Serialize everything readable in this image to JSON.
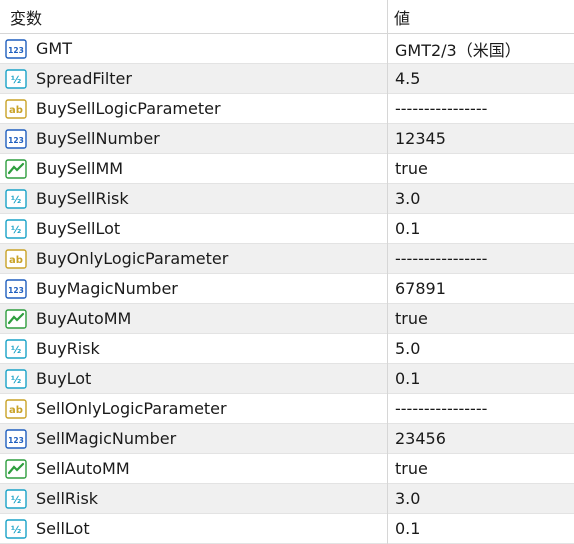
{
  "header": {
    "name": "変数",
    "value": "値"
  },
  "rows": [
    {
      "type": "int",
      "name": "GMT",
      "value": "GMT2/3（米国）"
    },
    {
      "type": "double",
      "name": "SpreadFilter",
      "value": "4.5"
    },
    {
      "type": "string",
      "name": "BuySellLogicParameter",
      "value": "----------------"
    },
    {
      "type": "int",
      "name": "BuySellNumber",
      "value": "12345"
    },
    {
      "type": "bool",
      "name": "BuySellMM",
      "value": "true"
    },
    {
      "type": "double",
      "name": "BuySellRisk",
      "value": "3.0"
    },
    {
      "type": "double",
      "name": "BuySellLot",
      "value": "0.1"
    },
    {
      "type": "string",
      "name": "BuyOnlyLogicParameter",
      "value": "----------------"
    },
    {
      "type": "int",
      "name": "BuyMagicNumber",
      "value": "67891"
    },
    {
      "type": "bool",
      "name": "BuyAutoMM",
      "value": "true"
    },
    {
      "type": "double",
      "name": "BuyRisk",
      "value": "5.0"
    },
    {
      "type": "double",
      "name": "BuyLot",
      "value": "0.1"
    },
    {
      "type": "string",
      "name": "SellOnlyLogicParameter",
      "value": "----------------"
    },
    {
      "type": "int",
      "name": "SellMagicNumber",
      "value": "23456"
    },
    {
      "type": "bool",
      "name": "SellAutoMM",
      "value": "true"
    },
    {
      "type": "double",
      "name": "SellRisk",
      "value": "3.0"
    },
    {
      "type": "double",
      "name": "SellLot",
      "value": "0.1"
    }
  ],
  "icons": {
    "int": {
      "name": "int-type-icon",
      "label": "123",
      "color": "#1f5fbf"
    },
    "double": {
      "name": "double-type-icon",
      "label": "½",
      "color": "#1aa3c8"
    },
    "string": {
      "name": "string-type-icon",
      "label": "ab",
      "color": "#c9a227"
    },
    "bool": {
      "name": "bool-type-icon",
      "label": "",
      "color": "#2e9e3e"
    }
  }
}
